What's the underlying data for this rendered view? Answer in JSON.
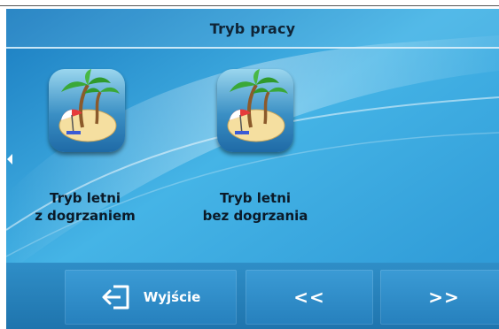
{
  "screen": {
    "title": "Tryb pracy"
  },
  "modes": [
    {
      "line1": "Tryb letni",
      "line2": "z dogrzaniem",
      "icon": "beach-island-icon"
    },
    {
      "line1": "Tryb letni",
      "line2": "bez dogrzania",
      "icon": "beach-island-icon"
    }
  ],
  "bottom_bar": {
    "exit_label": "Wyjście",
    "exit_icon": "exit-door-icon",
    "prev_label": "<<",
    "next_label": ">>"
  },
  "colors": {
    "background": "#39a9df",
    "title_text": "#0f2436",
    "button": "#2a86c3",
    "button_text": "#ffffff"
  }
}
